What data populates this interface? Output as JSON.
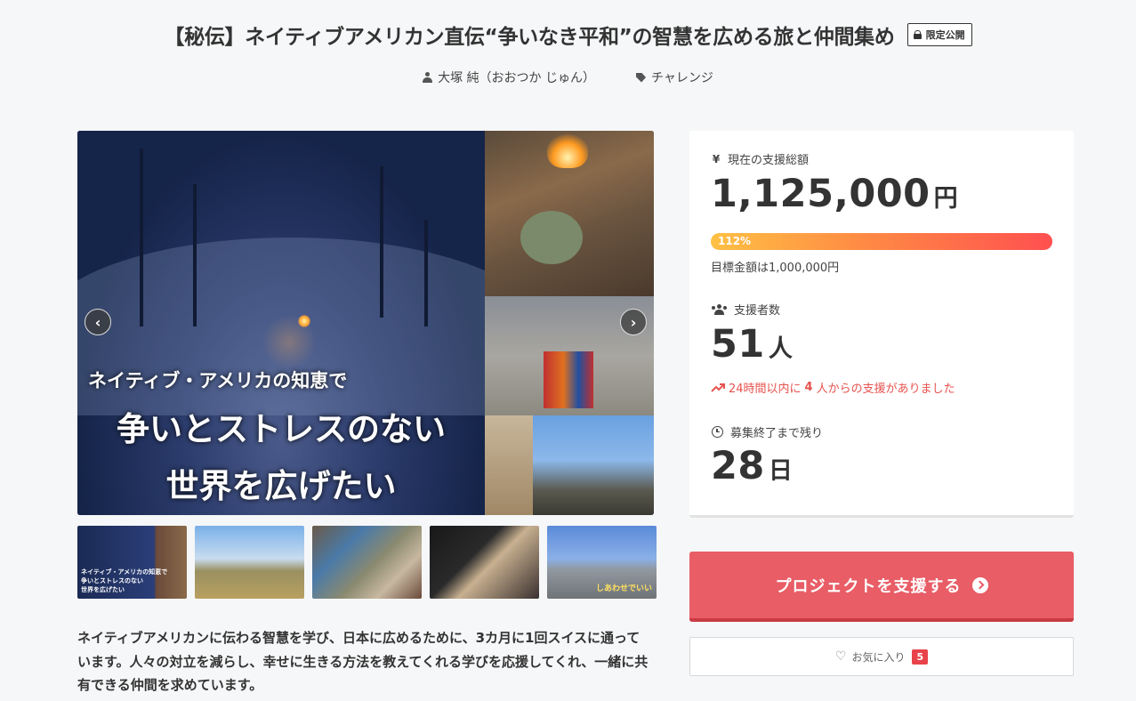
{
  "project": {
    "title": "【秘伝】ネイティブアメリカン直伝“争いなき平和”の智慧を広める旅と仲間集め",
    "visibility_badge": "限定公開",
    "author": "大塚 純（おおつか じゅん）",
    "category": "チャレンジ"
  },
  "hero": {
    "subtitle": "ネイティブ・アメリカの知恵で",
    "headline_line1": "争いとストレスのない",
    "headline_line2": "世界を広げたい",
    "prev_icon": "chevron-left-icon",
    "next_icon": "chevron-right-icon"
  },
  "thumbnails": [
    {
      "name": "thumbnail-1"
    },
    {
      "name": "thumbnail-2"
    },
    {
      "name": "thumbnail-3"
    },
    {
      "name": "thumbnail-4"
    },
    {
      "name": "thumbnail-5"
    }
  ],
  "description": "ネイティブアメリカンに伝わる智慧を学び、日本に広めるために、3カ月に1回スイスに通っています。人々の対立を減らし、幸せに生きる方法を教えてくれる学びを応援してくれ、一緒に共有できる仲間を求めています。",
  "stats": {
    "funding": {
      "label": "現在の支援総額",
      "amount": "1,125,000",
      "unit": "円",
      "progress_percent": 112,
      "progress_label": "112%",
      "goal_text": "目標金額は1,000,000円"
    },
    "backers": {
      "label": "支援者数",
      "count": "51",
      "unit": "人",
      "recent_prefix": "24時間以内に",
      "recent_count": "4",
      "recent_suffix": "人からの支援がありました"
    },
    "remaining": {
      "label": "募集終了まで残り",
      "days": "28",
      "unit": "日"
    }
  },
  "actions": {
    "support_label": "プロジェクトを支援する",
    "favorite_label": "お気に入り",
    "favorite_count": "5"
  },
  "colors": {
    "accent": "#e85d66",
    "progress_start": "#ffc044",
    "progress_end": "#ff5050",
    "highlight_text": "#e6534f"
  }
}
